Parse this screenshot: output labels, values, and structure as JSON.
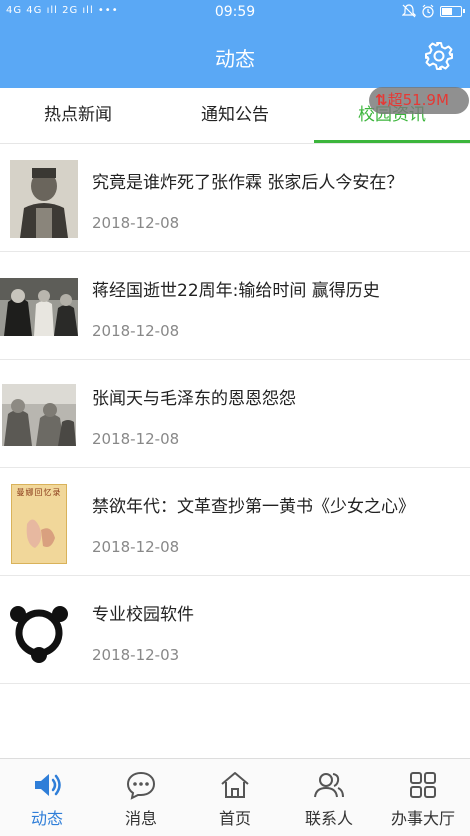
{
  "status_bar": {
    "left": "4G 4G ıll 2G ıll •••",
    "time": "09:59",
    "battery_level": 0.6
  },
  "header": {
    "title": "动态"
  },
  "tabs": [
    {
      "label": "热点新闻"
    },
    {
      "label": "通知公告"
    },
    {
      "label": "校园资讯"
    }
  ],
  "speed_badge": {
    "text": "超51.9M"
  },
  "news": [
    {
      "title": "究竟是谁炸死了张作霖 张家后人今安在？",
      "date": "2018-12-08"
    },
    {
      "title": "蒋经国逝世22周年:输给时间 赢得历史",
      "date": "2018-12-08"
    },
    {
      "title": "张闻天与毛泽东的恩恩怨怨",
      "date": "2018-12-08"
    },
    {
      "title": "禁欲年代：文革查抄第一黄书《少女之心》",
      "date": "2018-12-08"
    },
    {
      "title": "专业校园软件",
      "date": "2018-12-03"
    }
  ],
  "poster_text": "曼娜回忆录",
  "bottom_nav": [
    {
      "label": "动态"
    },
    {
      "label": "消息"
    },
    {
      "label": "首页"
    },
    {
      "label": "联系人"
    },
    {
      "label": "办事大厅"
    }
  ],
  "colors": {
    "primary": "#5aa8f5",
    "active_tab": "#3cb53c",
    "active_nav": "#2f7ed8"
  }
}
